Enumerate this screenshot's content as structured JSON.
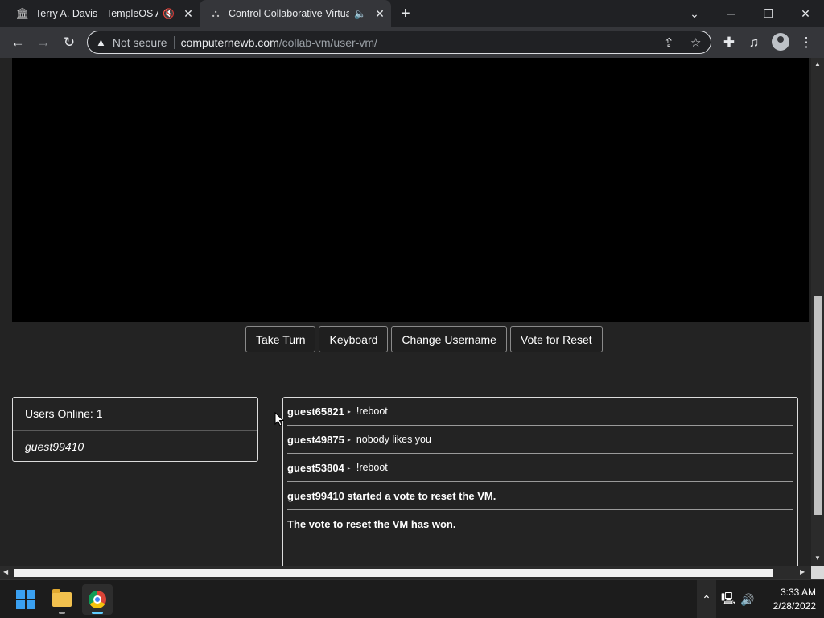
{
  "tabs": [
    {
      "title": "Terry A. Davis - TempleOS Ar",
      "icon": "museum-icon",
      "muted_icon": "speaker-muted-icon",
      "close": "✕"
    },
    {
      "title": "Control Collaborative Virtual",
      "icon": "site-favicon-icon",
      "muted_icon": "speaker-icon",
      "close": "✕"
    }
  ],
  "new_tab": "+",
  "window": {
    "minimize": "─",
    "restore": "❐",
    "close": "✕",
    "tab_search": "⌄"
  },
  "omnibox": {
    "security_label": "Not secure",
    "url_host": "computernewb.com",
    "url_path": "/collab-vm/user-vm/"
  },
  "vm_buttons": {
    "take_turn": "Take Turn",
    "keyboard": "Keyboard",
    "change_username": "Change Username",
    "vote_reset": "Vote for Reset"
  },
  "users_panel": {
    "header": "Users Online: 1",
    "users": [
      "guest99410"
    ]
  },
  "chat": [
    {
      "user": "guest65821",
      "text": "!reboot"
    },
    {
      "user": "guest49875",
      "text": "nobody likes you"
    },
    {
      "user": "guest53804",
      "text": "!reboot"
    },
    {
      "system": "guest99410 started a vote to reset the VM."
    },
    {
      "system": "The vote to reset the VM has won."
    }
  ],
  "clock": {
    "time": "3:33 AM",
    "date": "2/28/2022"
  },
  "colors": {
    "accent": "#60cdff",
    "page_bg": "#232323",
    "vm_screen": "#000000"
  }
}
